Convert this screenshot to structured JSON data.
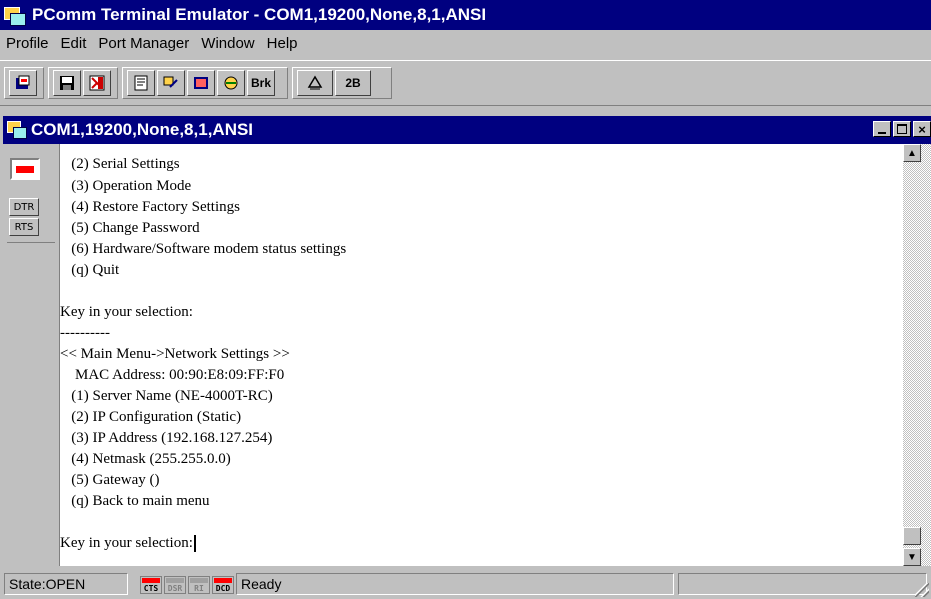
{
  "app": {
    "title": "PComm Terminal Emulator - COM1,19200,None,8,1,ANSI"
  },
  "menu": [
    "Profile",
    "Edit",
    "Port Manager",
    "Window",
    "Help"
  ],
  "toolbar": {
    "brk_label": "Brk",
    "twob_label": "2B"
  },
  "child": {
    "title": "COM1,19200,None,8,1,ANSI"
  },
  "side": {
    "dtr_label": "DTR",
    "rts_label": "RTS"
  },
  "terminal": {
    "lines": [
      "   (2) Serial Settings",
      "   (3) Operation Mode",
      "   (4) Restore Factory Settings",
      "   (5) Change Password",
      "   (6) Hardware/Software modem status settings",
      "   (q) Quit",
      "",
      "Key in your selection:",
      "----------",
      "<< Main Menu->Network Settings >>",
      "    MAC Address: 00:90:E8:09:FF:F0",
      "   (1) Server Name (NE-4000T-RC)",
      "   (2) IP Configuration (Static)",
      "   (3) IP Address (192.168.127.254)",
      "   (4) Netmask (255.255.0.0)",
      "   (5) Gateway ()",
      "   (q) Back to main menu",
      "",
      "Key in your selection:"
    ]
  },
  "status": {
    "state": "State:OPEN",
    "cts": "CTS",
    "dsr": "DSR",
    "ri": "RI",
    "dcd": "DCD",
    "ready": "Ready"
  },
  "colors": {
    "titlebar": "#000080",
    "face": "#c0c0c0",
    "led_on": "#ff0000",
    "led_off": "#808080"
  }
}
